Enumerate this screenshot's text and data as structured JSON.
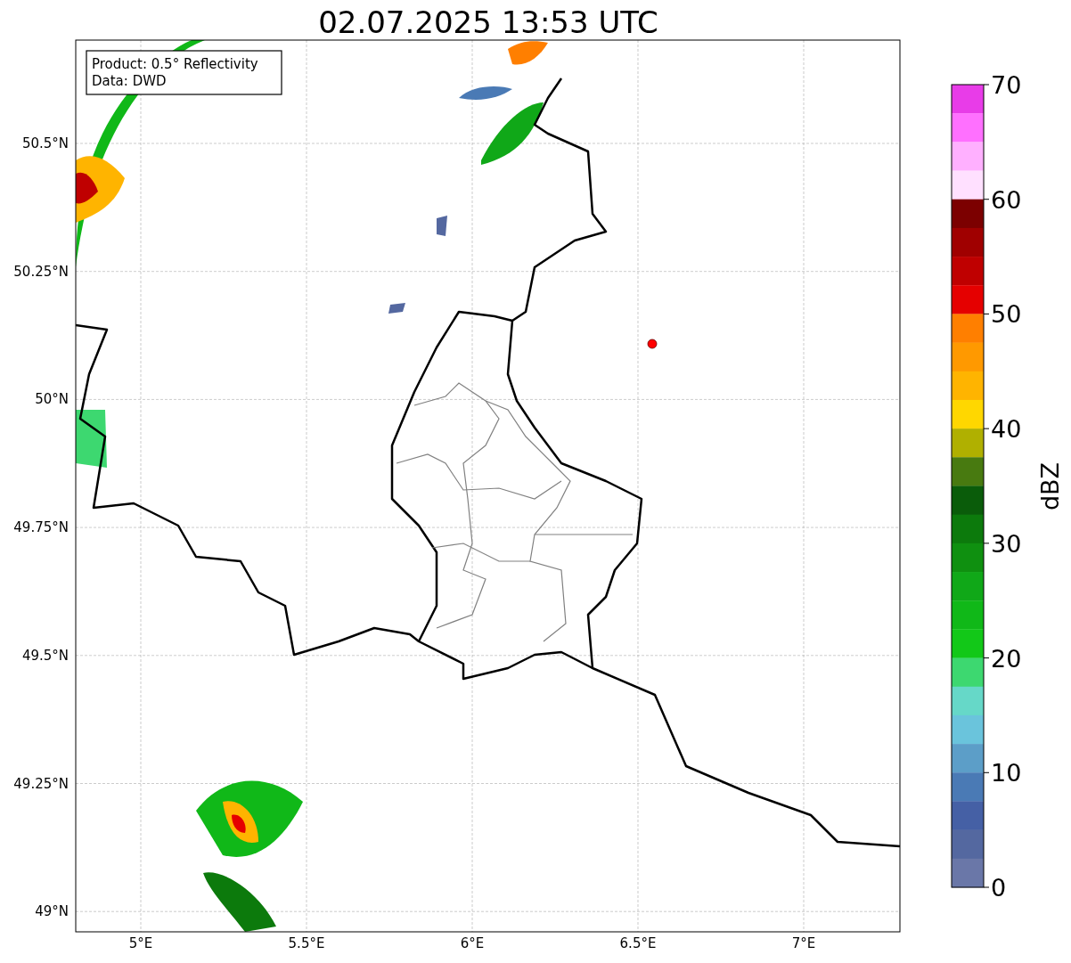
{
  "title": "02.07.2025 13:53 UTC",
  "info_box": {
    "lines": [
      "Product: 0.5° Reflectivity",
      "Data: DWD"
    ]
  },
  "axes": {
    "y_ticks": [
      "50.5°N",
      "50.25°N",
      "50°N",
      "49.75°N",
      "49.5°N",
      "49.25°N",
      "49°N"
    ],
    "x_ticks": [
      "5°E",
      "5.5°E",
      "6°E",
      "6.5°E",
      "7°E"
    ]
  },
  "colorbar": {
    "label": "dBZ",
    "ticks": [
      "70",
      "60",
      "50",
      "40",
      "30",
      "20",
      "10",
      "0"
    ],
    "bands": [
      {
        "color": "#e83ce8"
      },
      {
        "color": "#ff70ff"
      },
      {
        "color": "#ffb0ff"
      },
      {
        "color": "#ffe0ff"
      },
      {
        "color": "#7c0000"
      },
      {
        "color": "#a00000"
      },
      {
        "color": "#bf0000"
      },
      {
        "color": "#e50000"
      },
      {
        "color": "#ff7f00"
      },
      {
        "color": "#ff9900"
      },
      {
        "color": "#ffb400"
      },
      {
        "color": "#ffd700"
      },
      {
        "color": "#b0b000"
      },
      {
        "color": "#487a10"
      },
      {
        "color": "#0a5c0a"
      },
      {
        "color": "#0c7a0c"
      },
      {
        "color": "#0f9010"
      },
      {
        "color": "#10a818"
      },
      {
        "color": "#10b818"
      },
      {
        "color": "#12c818"
      },
      {
        "color": "#3dd870"
      },
      {
        "color": "#66d8c8"
      },
      {
        "color": "#6ac4dc"
      },
      {
        "color": "#5c9ec8"
      },
      {
        "color": "#4a7ab5"
      },
      {
        "color": "#4560a5"
      },
      {
        "color": "#5468a0"
      },
      {
        "color": "#6a77a8"
      }
    ]
  }
}
